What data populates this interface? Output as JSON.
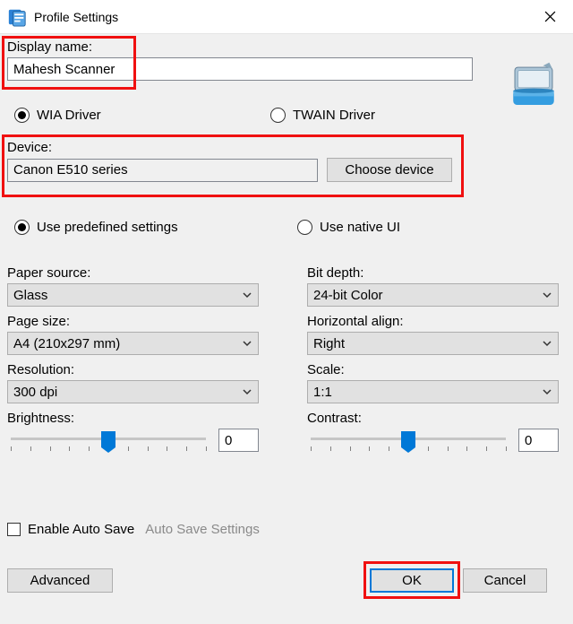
{
  "title": "Profile Settings",
  "display_name": {
    "label": "Display name:",
    "value": "Mahesh Scanner"
  },
  "driver": {
    "wia_label": "WIA Driver",
    "twain_label": "TWAIN Driver",
    "selected": "wia"
  },
  "device": {
    "label": "Device:",
    "value": "Canon E510 series",
    "choose_label": "Choose device"
  },
  "settings_mode": {
    "predefined_label": "Use predefined settings",
    "native_label": "Use native UI",
    "selected": "predefined"
  },
  "paper_source": {
    "label": "Paper source:",
    "value": "Glass"
  },
  "page_size": {
    "label": "Page size:",
    "value": "A4 (210x297 mm)"
  },
  "resolution": {
    "label": "Resolution:",
    "value": "300 dpi"
  },
  "bit_depth": {
    "label": "Bit depth:",
    "value": "24-bit Color"
  },
  "halign": {
    "label": "Horizontal align:",
    "value": "Right"
  },
  "scale": {
    "label": "Scale:",
    "value": "1:1"
  },
  "brightness": {
    "label": "Brightness:",
    "value": "0",
    "position": 0.5
  },
  "contrast": {
    "label": "Contrast:",
    "value": "0",
    "position": 0.5
  },
  "auto_save": {
    "checkbox_label": "Enable Auto Save",
    "settings_label": "Auto Save Settings",
    "checked": false
  },
  "buttons": {
    "advanced": "Advanced",
    "ok": "OK",
    "cancel": "Cancel"
  },
  "icons": {
    "app": "profile-icon",
    "scanner": "scanner-icon",
    "close": "✕",
    "chevron": "chevron-down-icon"
  }
}
